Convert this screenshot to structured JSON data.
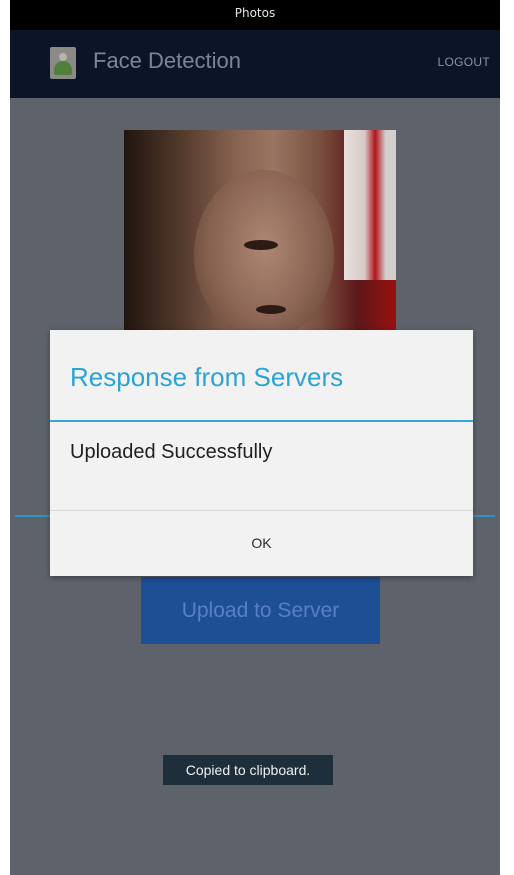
{
  "status_bar": {
    "title": "Photos"
  },
  "action_bar": {
    "title": "Face Detection",
    "icon": "gallery-app-icon",
    "logout_label": "LOGOUT"
  },
  "main": {
    "photo": {
      "icon": "face-photo"
    },
    "upload_button_label": "Upload to Server"
  },
  "dialog": {
    "title": "Response from Servers",
    "message": "Uploaded Successfully",
    "ok_label": "OK"
  },
  "toast": {
    "text": "Copied to clipboard."
  },
  "colors": {
    "action_bar": "#0c1527",
    "accent": "#34a8d8",
    "upload_button": "#1e4f95",
    "dialog_background": "#f2f2f2"
  }
}
